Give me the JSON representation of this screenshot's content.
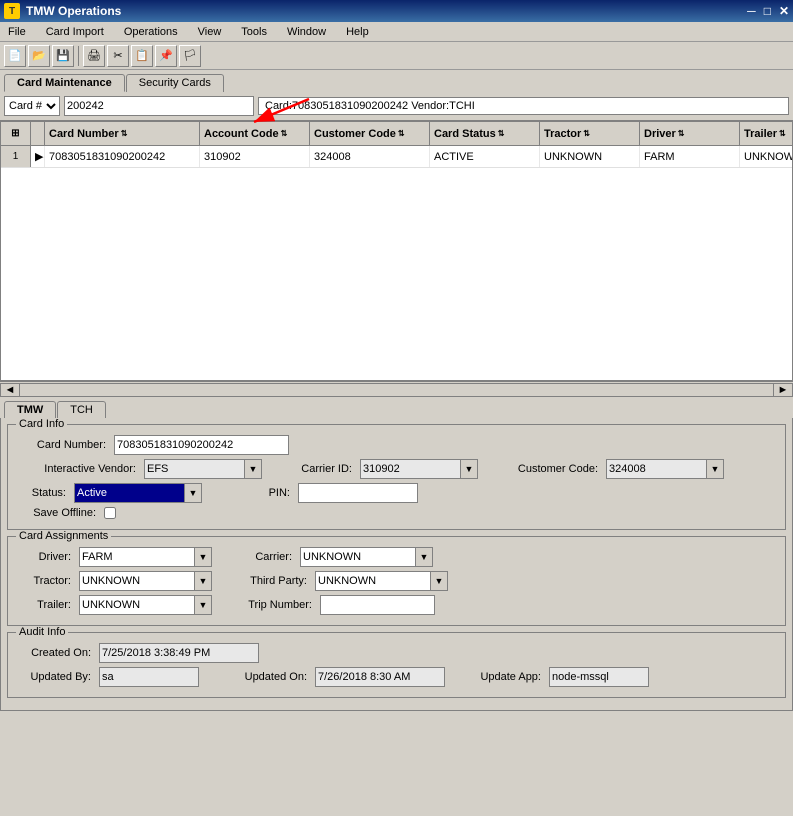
{
  "titleBar": {
    "icon": "T",
    "title": "TMW Operations"
  },
  "menuBar": {
    "items": [
      "File",
      "Card Import",
      "Operations",
      "View",
      "Tools",
      "Window",
      "Help"
    ]
  },
  "toolbar": {
    "buttons": [
      "new",
      "open",
      "save",
      "print",
      "cut",
      "copy",
      "paste",
      "find",
      "refresh"
    ]
  },
  "tabs": {
    "cardMaintenance": "Card Maintenance",
    "securityCards": "Security Cards"
  },
  "searchBar": {
    "fieldLabel": "Card #",
    "searchValue": "200242",
    "infoText": "Card:7083051831090200242 Vendor:TCHI"
  },
  "gridColumns": {
    "rowNum": "#",
    "cardNumber": "Card Number",
    "accountCode": "Account Code",
    "customerCode": "Customer Code",
    "cardStatus": "Card Status",
    "tractor": "Tractor",
    "driver": "Driver",
    "trailer": "Trailer"
  },
  "gridRows": [
    {
      "rowNum": "1",
      "cardNumber": "7083051831090200242",
      "accountCode": "310902",
      "customerCode": "324008",
      "cardStatus": "ACTIVE",
      "tractor": "UNKNOWN",
      "driver": "FARM",
      "trailer": "UNKNOWN"
    }
  ],
  "bottomTabs": [
    "TMW",
    "TCH"
  ],
  "cardInfo": {
    "sectionTitle": "Card Info",
    "cardNumberLabel": "Card Number:",
    "cardNumberValue": "7083051831090200242",
    "interactiveVendorLabel": "Interactive Vendor:",
    "interactiveVendorValue": "EFS",
    "carrierIdLabel": "Carrier ID:",
    "carrierIdValue": "310902",
    "customerCodeLabel": "Customer Code:",
    "customerCodeValue": "324008",
    "statusLabel": "Status:",
    "statusValue": "Active",
    "pinLabel": "PIN:",
    "pinValue": "",
    "saveOfflineLabel": "Save Offline:"
  },
  "cardAssignments": {
    "sectionTitle": "Card Assignments",
    "driverLabel": "Driver:",
    "driverValue": "FARM",
    "carrierLabel": "Carrier:",
    "carrierValue": "UNKNOWN",
    "tractorLabel": "Tractor:",
    "tractorValue": "UNKNOWN",
    "thirdPartyLabel": "Third Party:",
    "thirdPartyValue": "UNKNOWN",
    "trailerLabel": "Trailer:",
    "trailerValue": "UNKNOWN",
    "tripNumberLabel": "Trip Number:",
    "tripNumberValue": ""
  },
  "auditInfo": {
    "sectionTitle": "Audit Info",
    "createdOnLabel": "Created On:",
    "createdOnValue": "7/25/2018 3:38:49 PM",
    "updatedByLabel": "Updated By:",
    "updatedByValue": "sa",
    "updatedOnLabel": "Updated On:",
    "updatedOnValue": "7/26/2018 8:30 AM",
    "updateAppLabel": "Update App:",
    "updateAppValue": "node-mssql"
  },
  "colors": {
    "titleBarStart": "#0a246a",
    "titleBarEnd": "#3a6ea5",
    "activeStatusBg": "#00008b",
    "selectedRowBg": "#0a246a"
  }
}
